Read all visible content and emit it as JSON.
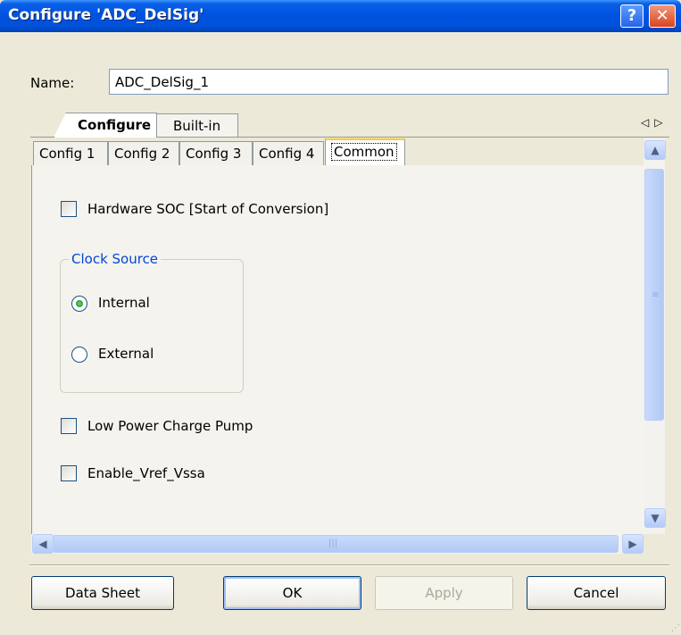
{
  "window": {
    "title": "Configure 'ADC_DelSig'",
    "help_glyph": "?",
    "close_glyph": "✕",
    "colors": {
      "titlebar": "#0054E3",
      "accent": "#0046D5",
      "radio_checked": "#21A121"
    }
  },
  "name_field": {
    "label": "Name:",
    "value": "ADC_DelSig_1"
  },
  "outer_tabs": [
    {
      "label": "Configure",
      "active": true
    },
    {
      "label": "Built-in",
      "active": false
    }
  ],
  "tab_scroll_arrows": {
    "left": "◁",
    "right": "▷"
  },
  "inner_tabs": [
    {
      "label": "Config 1",
      "active": false
    },
    {
      "label": "Config 2",
      "active": false
    },
    {
      "label": "Config 3",
      "active": false
    },
    {
      "label": "Config 4",
      "active": false
    },
    {
      "label": "Common",
      "active": true
    }
  ],
  "common": {
    "hardware_soc": {
      "label": "Hardware SOC [Start of Conversion]",
      "checked": false
    },
    "clock_source": {
      "title": "Clock Source",
      "options": [
        {
          "label": "Internal",
          "selected": true
        },
        {
          "label": "External",
          "selected": false
        }
      ]
    },
    "low_power_charge_pump": {
      "label": "Low Power Charge Pump",
      "checked": false
    },
    "enable_vref_vssa": {
      "label": "Enable_Vref_Vssa",
      "checked": false
    }
  },
  "icons": {
    "scroll_up": "chevron-up-icon",
    "scroll_down": "chevron-down-icon",
    "scroll_left": "chevron-left-icon",
    "scroll_right": "chevron-right-icon"
  },
  "buttons": {
    "data_sheet": "Data Sheet",
    "ok": "OK",
    "apply": "Apply",
    "cancel": "Cancel"
  }
}
